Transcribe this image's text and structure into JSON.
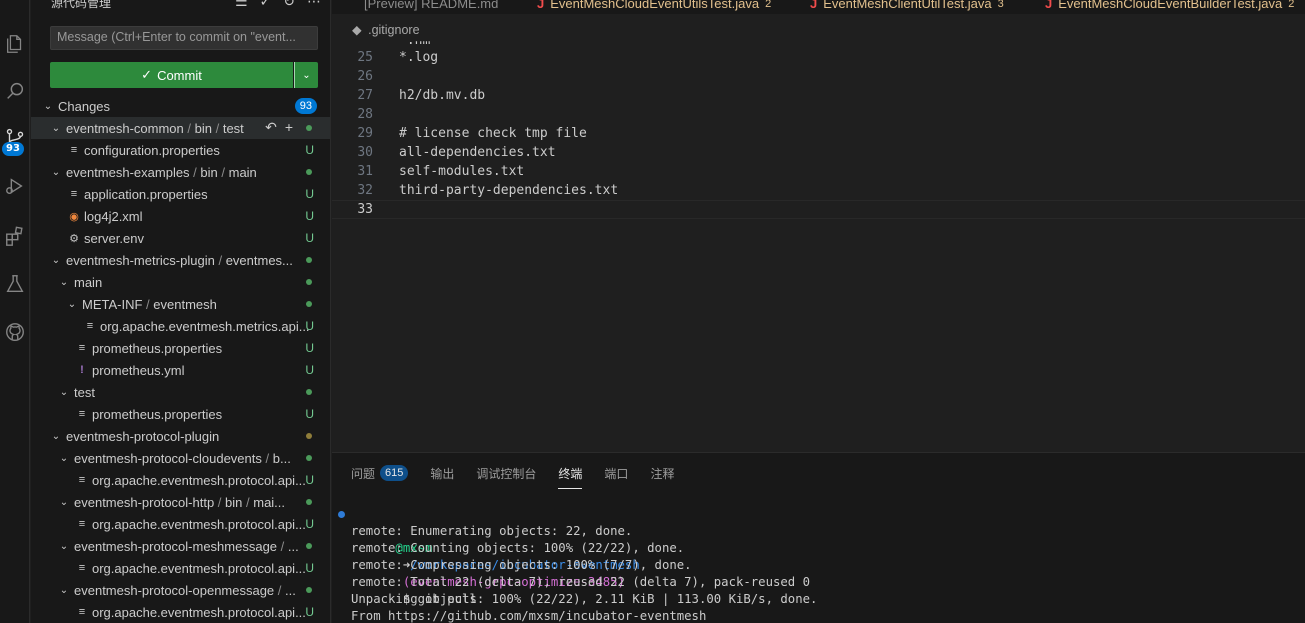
{
  "activity_bar": {
    "items": [
      {
        "icon": "files-icon"
      },
      {
        "icon": "search-icon"
      },
      {
        "icon": "source-control-icon",
        "badge": "93"
      },
      {
        "icon": "run-debug-icon"
      },
      {
        "icon": "extensions-icon"
      },
      {
        "icon": "testing-icon"
      },
      {
        "icon": "github-icon"
      }
    ]
  },
  "sidebar": {
    "title": "源代码管理",
    "commit_placeholder": "Message (Ctrl+Enter to commit on \"event...",
    "commit_label": "Commit",
    "changes_label": "Changes",
    "changes_count": "93",
    "tree": [
      {
        "type": "folder",
        "depth": 0,
        "parts": [
          "eventmesh-common",
          "bin",
          "test"
        ],
        "marker": "dot",
        "selected": true
      },
      {
        "type": "file",
        "depth": 1,
        "icon": "lines",
        "label": "configuration.properties",
        "status": "U"
      },
      {
        "type": "folder",
        "depth": 0,
        "parts": [
          "eventmesh-examples",
          "bin",
          "main"
        ],
        "marker": "dot"
      },
      {
        "type": "file",
        "depth": 1,
        "icon": "lines",
        "label": "application.properties",
        "status": "U"
      },
      {
        "type": "file",
        "depth": 1,
        "icon": "rss",
        "label": "log4j2.xml",
        "status": "U"
      },
      {
        "type": "file",
        "depth": 1,
        "icon": "gear",
        "label": "server.env",
        "status": "U"
      },
      {
        "type": "folder",
        "depth": 0,
        "parts": [
          "eventmesh-metrics-plugin",
          "eventmes..."
        ],
        "marker": "dot"
      },
      {
        "type": "folder",
        "depth": 1,
        "parts": [
          "main"
        ],
        "marker": "dot"
      },
      {
        "type": "folder",
        "depth": 2,
        "parts": [
          "META-INF",
          "eventmesh"
        ],
        "marker": "dot"
      },
      {
        "type": "file",
        "depth": 3,
        "icon": "lines",
        "label": "org.apache.eventmesh.metrics.api...",
        "status": "U"
      },
      {
        "type": "file",
        "depth": 2,
        "icon": "lines",
        "label": "prometheus.properties",
        "status": "U"
      },
      {
        "type": "file",
        "depth": 2,
        "icon": "excl",
        "label": "prometheus.yml",
        "status": "U"
      },
      {
        "type": "folder",
        "depth": 1,
        "parts": [
          "test"
        ],
        "marker": "dot"
      },
      {
        "type": "file",
        "depth": 2,
        "icon": "lines",
        "label": "prometheus.properties",
        "status": "U"
      },
      {
        "type": "folder",
        "depth": 0,
        "parts": [
          "eventmesh-protocol-plugin"
        ],
        "marker": "dot-mod"
      },
      {
        "type": "folder",
        "depth": 1,
        "parts": [
          "eventmesh-protocol-cloudevents",
          "b..."
        ],
        "marker": "dot"
      },
      {
        "type": "file",
        "depth": 2,
        "icon": "lines",
        "label": "org.apache.eventmesh.protocol.api...",
        "status": "U"
      },
      {
        "type": "folder",
        "depth": 1,
        "parts": [
          "eventmesh-protocol-http",
          "bin",
          "mai..."
        ],
        "marker": "dot"
      },
      {
        "type": "file",
        "depth": 2,
        "icon": "lines",
        "label": "org.apache.eventmesh.protocol.api...",
        "status": "U"
      },
      {
        "type": "folder",
        "depth": 1,
        "parts": [
          "eventmesh-protocol-meshmessage",
          "..."
        ],
        "marker": "dot"
      },
      {
        "type": "file",
        "depth": 2,
        "icon": "lines",
        "label": "org.apache.eventmesh.protocol.api...",
        "status": "U"
      },
      {
        "type": "folder",
        "depth": 1,
        "parts": [
          "eventmesh-protocol-openmessage",
          "..."
        ],
        "marker": "dot"
      },
      {
        "type": "file",
        "depth": 2,
        "icon": "lines",
        "label": "org.apache.eventmesh.protocol.api...",
        "status": "U"
      }
    ]
  },
  "tabs": [
    {
      "label": "[Preview] README.md",
      "kind": "preview"
    },
    {
      "label": "EventMeshCloudEventUtilsTest.java",
      "count": "2",
      "kind": "java"
    },
    {
      "label": "EventMeshClientUtilTest.java",
      "count": "3",
      "kind": "java"
    },
    {
      "label": "EventMeshCloudEventBuilderTest.java",
      "count": "2",
      "kind": "java"
    }
  ],
  "breadcrumb": ".gitignore",
  "editor": {
    "lines": [
      {
        "n": "25",
        "text": "*.log"
      },
      {
        "n": "26",
        "text": ""
      },
      {
        "n": "27",
        "text": "h2/db.mv.db"
      },
      {
        "n": "28",
        "text": ""
      },
      {
        "n": "29",
        "text": "# license check tmp file"
      },
      {
        "n": "30",
        "text": "all-dependencies.txt"
      },
      {
        "n": "31",
        "text": "self-modules.txt"
      },
      {
        "n": "32",
        "text": "third-party-dependencies.txt"
      },
      {
        "n": "33",
        "text": "",
        "current": true
      }
    ]
  },
  "panel": {
    "tabs": [
      {
        "label": "问题",
        "badge": "615"
      },
      {
        "label": "输出"
      },
      {
        "label": "调试控制台"
      },
      {
        "label": "终端",
        "active": true
      },
      {
        "label": "端口"
      },
      {
        "label": "注释"
      }
    ],
    "terminal": {
      "prompt_user": "@mxsm",
      "prompt_arrow": "➜",
      "prompt_path": "/workspaces/incubator-eventmesh",
      "prompt_branch": "(eventmesh-grpc-optimize-3485)",
      "command": "$ git pull",
      "output": [
        "remote: Enumerating objects: 22, done.",
        "remote: Counting objects: 100% (22/22), done.",
        "remote: Compressing objects: 100% (7/7), done.",
        "remote: Total 22 (delta 7), reused 22 (delta 7), pack-reused 0",
        "Unpacking objects: 100% (22/22), 2.11 KiB | 113.00 KiB/s, done.",
        "From https://github.com/mxsm/incubator-eventmesh"
      ]
    }
  },
  "colors": {
    "commit_green": "#2d8a3c",
    "badge_blue": "#0078d4",
    "untracked_green": "#73c991"
  }
}
